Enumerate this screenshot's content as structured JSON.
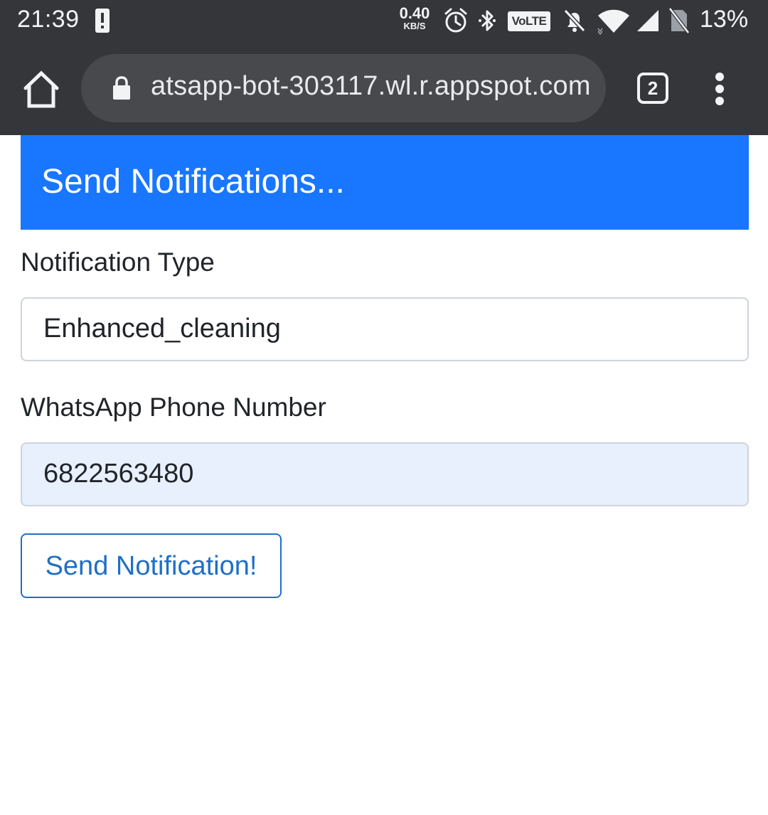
{
  "status_bar": {
    "time": "21:39",
    "net_speed_value": "0.40",
    "net_speed_unit": "KB/S",
    "volte_label": "VoLTE",
    "battery_percent": "13%",
    "icons": [
      "alert-icon",
      "alarm-icon",
      "bluetooth-icon",
      "volte-icon",
      "mute-icon",
      "wifi-icon",
      "signal-icon",
      "no-sim-icon"
    ]
  },
  "browser": {
    "url": "atsapp-bot-303117.wl.r.appspot.com",
    "tab_count": "2",
    "icons": [
      "home-icon",
      "lock-icon",
      "tab-switcher-icon",
      "more-vert-icon"
    ]
  },
  "page": {
    "header_title": "Send Notifications...",
    "notification_type": {
      "label": "Notification Type",
      "value": "Enhanced_cleaning"
    },
    "phone": {
      "label": "WhatsApp Phone Number",
      "value": "6822563480"
    },
    "submit_label": "Send Notification!"
  },
  "colors": {
    "chrome_bar": "#35363a",
    "omnibox": "#48494d",
    "header_blue": "#1976ff",
    "button_blue": "#1f6fc5",
    "autofill_bg": "#e8f0fe"
  }
}
